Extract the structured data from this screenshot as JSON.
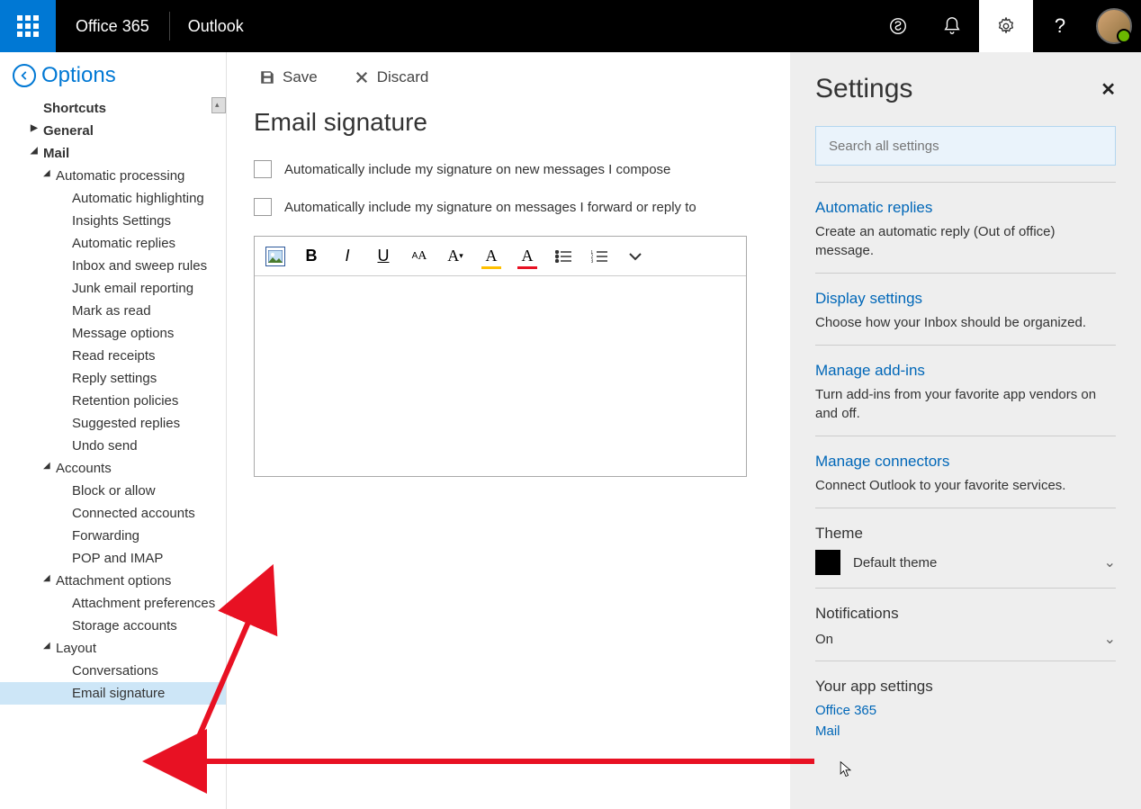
{
  "header": {
    "brand": "Office 365",
    "app": "Outlook"
  },
  "options": {
    "title": "Options",
    "tree": {
      "shortcuts": "Shortcuts",
      "general": "General",
      "mail": "Mail",
      "auto_processing": "Automatic processing",
      "auto_highlighting": "Automatic highlighting",
      "insights": "Insights Settings",
      "auto_replies": "Automatic replies",
      "inbox_rules": "Inbox and sweep rules",
      "junk": "Junk email reporting",
      "mark_read": "Mark as read",
      "msg_options": "Message options",
      "read_receipts": "Read receipts",
      "reply_settings": "Reply settings",
      "retention": "Retention policies",
      "suggested": "Suggested replies",
      "undo": "Undo send",
      "accounts": "Accounts",
      "block_allow": "Block or allow",
      "connected": "Connected accounts",
      "forwarding": "Forwarding",
      "pop_imap": "POP and IMAP",
      "attach_opts": "Attachment options",
      "attach_prefs": "Attachment preferences",
      "storage": "Storage accounts",
      "layout": "Layout",
      "conversations": "Conversations",
      "email_sig": "Email signature"
    }
  },
  "content": {
    "save": "Save",
    "discard": "Discard",
    "title": "Email signature",
    "check1": "Automatically include my signature on new messages I compose",
    "check2": "Automatically include my signature on messages I forward or reply to"
  },
  "settings": {
    "title": "Settings",
    "search_placeholder": "Search all settings",
    "auto_replies_title": "Automatic replies",
    "auto_replies_desc": "Create an automatic reply (Out of office) message.",
    "display_title": "Display settings",
    "display_desc": "Choose how your Inbox should be organized.",
    "addins_title": "Manage add-ins",
    "addins_desc": "Turn add-ins from your favorite app vendors on and off.",
    "connectors_title": "Manage connectors",
    "connectors_desc": "Connect Outlook to your favorite services.",
    "theme_label": "Theme",
    "theme_value": "Default theme",
    "notif_label": "Notifications",
    "notif_value": "On",
    "app_settings_label": "Your app settings",
    "app_links": {
      "office365": "Office 365",
      "mail": "Mail"
    }
  }
}
